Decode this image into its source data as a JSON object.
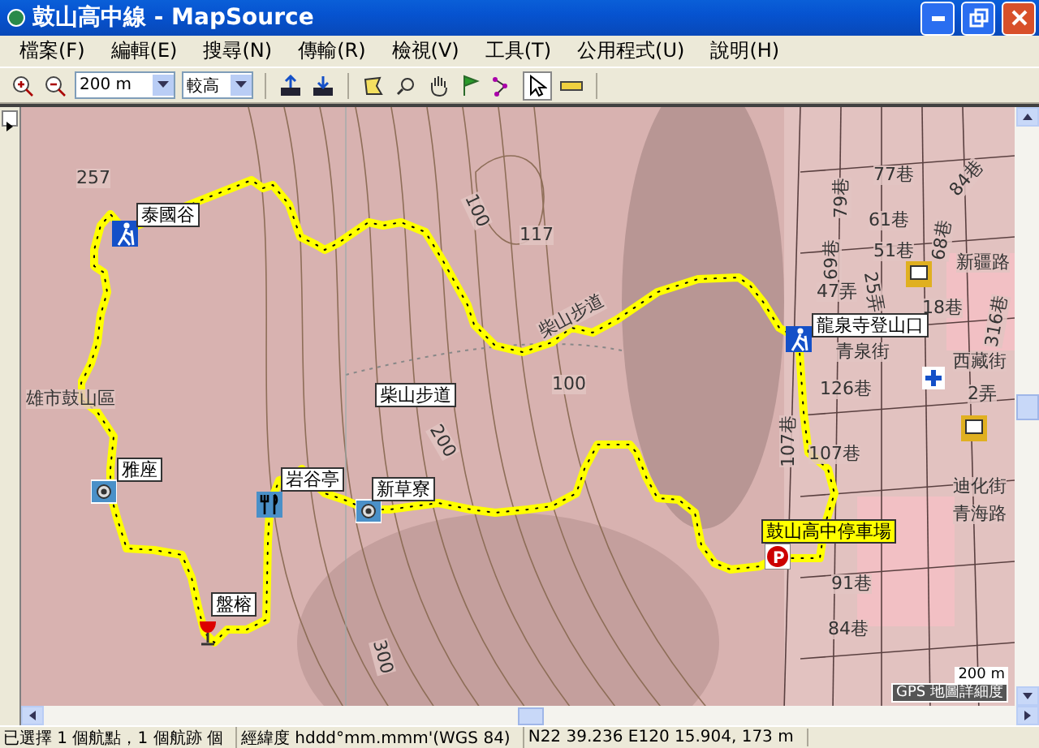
{
  "window": {
    "title": "鼓山高中線 - MapSource"
  },
  "menu": [
    "檔案(F)",
    "編輯(E)",
    "搜尋(N)",
    "傳輸(R)",
    "檢視(V)",
    "工具(T)",
    "公用程式(U)",
    "說明(H)"
  ],
  "toolbar": {
    "scale": "200 m",
    "detail": "較高"
  },
  "waypoints": [
    {
      "label": "泰國谷",
      "selected": false
    },
    {
      "label": "柴山步道",
      "selected": false
    },
    {
      "label": "雅座",
      "selected": false
    },
    {
      "label": "岩谷亭",
      "selected": false
    },
    {
      "label": "新草寮",
      "selected": false
    },
    {
      "label": "盤榕",
      "selected": false
    },
    {
      "label": "龍泉寺登山口",
      "selected": false
    },
    {
      "label": "鼓山高中停車場",
      "selected": true
    }
  ],
  "map_labels": [
    "257",
    "117",
    "100",
    "100",
    "200",
    "300",
    "雄市鼓山區",
    "柴山步道",
    "77巷",
    "79巷",
    "61巷",
    "69巷",
    "68巷",
    "84巷",
    "51巷",
    "新疆路",
    "47弄",
    "25弄",
    "18巷",
    "青泉街",
    "316巷",
    "西藏街",
    "126巷",
    "2弄",
    "107巷",
    "107巷",
    "迪化街",
    "青海路",
    "91巷",
    "84巷"
  ],
  "parking_sign": "P",
  "scale_bar": {
    "distance": "200 m",
    "detail": "GPS 地圖詳細度"
  },
  "status_bar": [
    "已選擇 1 個航點，1 個航跡 個",
    "經緯度 hddd°mm.mmm'(WGS 84)",
    "N22 39.236 E120 15.904, 173 m"
  ]
}
